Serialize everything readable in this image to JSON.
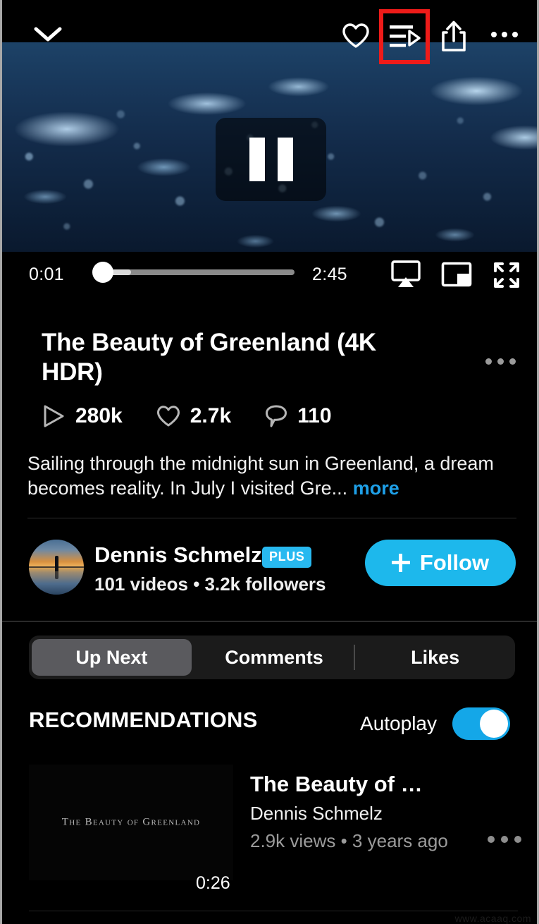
{
  "topbar": {
    "collapse_icon": "chevron-down-icon",
    "like_icon": "heart-icon",
    "queue_icon": "watch-later-queue-icon",
    "share_icon": "share-icon",
    "more_icon": "more-options-icon"
  },
  "player": {
    "state": "paused",
    "pause_icon": "pause-icon",
    "current_time": "0:01",
    "duration": "2:45",
    "progress_percent": 13,
    "airplay_icon": "airplay-icon",
    "pip_icon": "picture-in-picture-icon",
    "fullscreen_icon": "fullscreen-icon"
  },
  "video": {
    "title": "The Beauty of Greenland (4K HDR)",
    "more_icon": "more-options-icon",
    "stats": [
      {
        "icon": "play-icon",
        "value": "280k"
      },
      {
        "icon": "heart-icon",
        "value": "2.7k"
      },
      {
        "icon": "comment-icon",
        "value": "110"
      }
    ],
    "description": "Sailing through the midnight sun in Greenland, a dream becomes reality. In July I visited Gre...",
    "more_label": "more"
  },
  "author": {
    "name": "Dennis Schmelz",
    "badge": "PLUS",
    "sub": "101 videos • 3.2k followers",
    "follow_label": "Follow",
    "follow_icon": "plus-icon"
  },
  "tabs": [
    {
      "label": "Up Next",
      "active": true
    },
    {
      "label": "Comments",
      "active": false
    },
    {
      "label": "Likes",
      "active": false
    }
  ],
  "recommendations": {
    "header": "RECOMMENDATIONS",
    "autoplay_label": "Autoplay",
    "autoplay_on": true,
    "items": [
      {
        "thumb_caption": "The Beauty of Greenland",
        "duration": "0:26",
        "title": "The Beauty of …",
        "author": "Dennis Schmelz",
        "stats": "2.9k views • 3 years ago",
        "more_icon": "more-options-icon"
      }
    ]
  },
  "colors": {
    "accent_blue": "#1db8ec",
    "link_blue": "#1ea0e8",
    "toggle_on": "#14a7e8",
    "highlight_box": "#ee1b19",
    "background": "#000000"
  },
  "watermark": "www.acaaq.com"
}
